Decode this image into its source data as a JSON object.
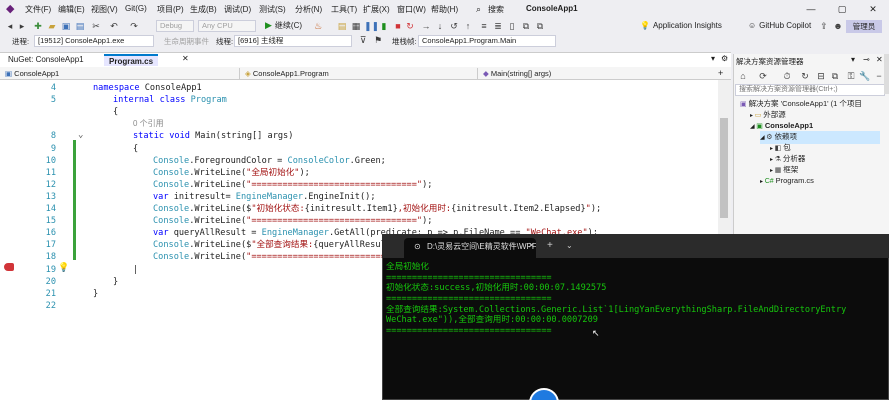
{
  "menu": {
    "items": [
      "文件(F)",
      "编辑(E)",
      "视图(V)",
      "Git(G)",
      "项目(P)",
      "生成(B)",
      "调试(D)",
      "测试(S)",
      "分析(N)",
      "工具(T)",
      "扩展(X)",
      "窗口(W)",
      "帮助(H)"
    ],
    "search_label": "搜索",
    "solution_title": "ConsoleApp1",
    "window_buttons": [
      "—",
      "▢",
      "✕"
    ]
  },
  "toolbar": {
    "config": "Debug",
    "platform": "Any CPU",
    "start_label": "继续(C)",
    "appinsights": "Application Insights",
    "copilot": "GitHub Copilot",
    "admin": "管理员"
  },
  "debugbar": {
    "process_label": "进程:",
    "process_value": "[19512] ConsoleApp1.exe",
    "lifecycle_label": "生命周期事件",
    "thread_label": "线程:",
    "thread_value": "[6916] 主线程",
    "stack_label": "堆栈帧:",
    "stack_value": "ConsoleApp1.Program.Main"
  },
  "tabs": {
    "nuget": "NuGet: ConsoleApp1",
    "program": "Program.cs",
    "close": "✕"
  },
  "navbar": {
    "project": "ConsoleApp1",
    "class": "ConsoleApp1.Program",
    "member": "Main(string[] args)"
  },
  "code": [
    {
      "ln": "4",
      "tokens": [
        [
          "kw",
          "namespace "
        ],
        [
          "plain",
          "ConsoleApp1"
        ]
      ],
      "indent": 0
    },
    {
      "ln": "5",
      "tokens": [
        [
          "kw",
          "internal class "
        ],
        [
          "type",
          "Program"
        ]
      ],
      "indent": 1
    },
    {
      "ln": "",
      "tokens": [
        [
          "plain",
          "{"
        ]
      ],
      "indent": 1
    },
    {
      "ln": "",
      "tokens": [
        [
          "ref",
          "0 个引用"
        ]
      ],
      "indent": 2
    },
    {
      "ln": "8",
      "tokens": [
        [
          "kw",
          "static void "
        ],
        [
          "plain",
          "Main(string[] args)"
        ]
      ],
      "indent": 2
    },
    {
      "ln": "9",
      "tokens": [
        [
          "plain",
          "{"
        ]
      ],
      "indent": 2
    },
    {
      "ln": "10",
      "tokens": [
        [
          "type",
          "Console"
        ],
        [
          "plain",
          ".ForegroundColor = "
        ],
        [
          "type",
          "ConsoleColor"
        ],
        [
          "plain",
          ".Green;"
        ]
      ],
      "indent": 3
    },
    {
      "ln": "11",
      "tokens": [
        [
          "type",
          "Console"
        ],
        [
          "plain",
          ".WriteLine("
        ],
        [
          "str",
          "\"全局初始化\""
        ],
        [
          "plain",
          ");"
        ]
      ],
      "indent": 3
    },
    {
      "ln": "12",
      "tokens": [
        [
          "type",
          "Console"
        ],
        [
          "plain",
          ".WriteLine("
        ],
        [
          "str",
          "\"================================\""
        ],
        [
          "plain",
          ");"
        ]
      ],
      "indent": 3
    },
    {
      "ln": "13",
      "tokens": [
        [
          "kw",
          "var "
        ],
        [
          "plain",
          "initresult= "
        ],
        [
          "type",
          "EngineManager"
        ],
        [
          "plain",
          ".EngineInit();"
        ]
      ],
      "indent": 3
    },
    {
      "ln": "14",
      "tokens": [
        [
          "type",
          "Console"
        ],
        [
          "plain",
          ".WriteLine($"
        ],
        [
          "str",
          "\"初始化状态:"
        ],
        [
          "plain",
          "{initresult.Item1}"
        ],
        [
          "str",
          ",初始化用时:"
        ],
        [
          "plain",
          "{initresult.Item2.Elapsed}"
        ],
        [
          "str",
          "\""
        ],
        [
          "plain",
          ");"
        ]
      ],
      "indent": 3
    },
    {
      "ln": "15",
      "tokens": [
        [
          "type",
          "Console"
        ],
        [
          "plain",
          ".WriteLine("
        ],
        [
          "str",
          "\"================================\""
        ],
        [
          "plain",
          ");"
        ]
      ],
      "indent": 3
    },
    {
      "ln": "16",
      "tokens": [
        [
          "kw",
          "var "
        ],
        [
          "plain",
          "queryAllResult = "
        ],
        [
          "type",
          "EngineManager"
        ],
        [
          "plain",
          ".GetAll(predicate: p => p.FileName == "
        ],
        [
          "str",
          "\"WeChat.exe\""
        ],
        [
          "plain",
          ");"
        ]
      ],
      "indent": 3
    },
    {
      "ln": "17",
      "tokens": [
        [
          "type",
          "Console"
        ],
        [
          "plain",
          ".WriteLine($"
        ],
        [
          "str",
          "\"全部查询结果:"
        ],
        [
          "plain",
          "{queryAllResult"
        ]
      ],
      "indent": 3
    },
    {
      "ln": "18",
      "tokens": [
        [
          "type",
          "Console"
        ],
        [
          "plain",
          ".WriteLine("
        ],
        [
          "str",
          "\"================================"
        ]
      ],
      "indent": 3
    },
    {
      "ln": "19",
      "tokens": [
        [
          "plain",
          "|"
        ]
      ],
      "indent": 2
    },
    {
      "ln": "20",
      "tokens": [
        [
          "plain",
          "}"
        ]
      ],
      "indent": 1
    },
    {
      "ln": "21",
      "tokens": [
        [
          "plain",
          "}"
        ]
      ],
      "indent": 0
    },
    {
      "ln": "22",
      "tokens": [],
      "indent": 0
    }
  ],
  "solution_explorer": {
    "title": "解决方案资源管理器",
    "search_placeholder": "搜索解决方案资源管理器(Ctrl+;)",
    "tree": [
      {
        "label": "解决方案 'ConsoleApp1' (1 个项目",
        "depth": 0,
        "icon": "solution-icon",
        "bold": false
      },
      {
        "label": "外部源",
        "depth": 1,
        "icon": "folder-icon",
        "bold": false
      },
      {
        "label": "ConsoleApp1",
        "depth": 1,
        "icon": "csharp-project-icon",
        "bold": true
      },
      {
        "label": "依赖项",
        "depth": 2,
        "icon": "dependencies-icon",
        "bold": false,
        "selected": true
      },
      {
        "label": "包",
        "depth": 3,
        "icon": "package-icon",
        "bold": false
      },
      {
        "label": "分析器",
        "depth": 3,
        "icon": "analyzer-icon",
        "bold": false
      },
      {
        "label": "框架",
        "depth": 3,
        "icon": "framework-icon",
        "bold": false
      },
      {
        "label": "Program.cs",
        "depth": 2,
        "icon": "csharp-file-icon",
        "bold": false
      }
    ]
  },
  "console": {
    "tab_title": "D:\\灵易云空间\\E精灵软件\\WPF",
    "lines": [
      "全局初始化",
      "================================",
      "初始化状态:success,初始化用时:00:00:07.1492575",
      "================================",
      "全部查询结果:System.Collections.Generic.List`1[LingYanEverythingSharp.FileAndDirectoryEntry",
      "WeChat.exe\")),全部查询用时:00:00:00.0007209",
      "================================"
    ]
  }
}
